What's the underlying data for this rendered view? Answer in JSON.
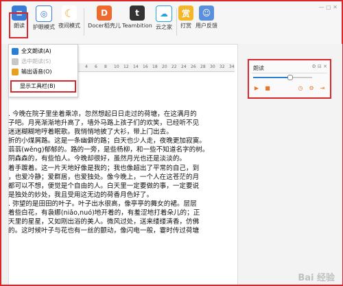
{
  "ribbon": {
    "read_label": "朗读",
    "eye_label": "护眼模式",
    "night_label": "夜间模式",
    "docer_label": "Docer稻壳儿",
    "teambition_label": "Teambition",
    "cloud_label": "云之家",
    "reward_label": "打赏",
    "feedback_label": "用户反馈"
  },
  "menu": {
    "full_read": "全文朗读(A)",
    "select_read": "选中朗读(S)",
    "output_voice": "输出语音(O)",
    "show_toolbar": "显示工具栏(B)"
  },
  "ruler": [
    "1",
    "2",
    "4",
    "6",
    "8",
    "10",
    "12",
    "14",
    "16",
    "18",
    "20",
    "22",
    "24",
    "26",
    "28",
    "30",
    "32",
    "34"
  ],
  "panel": {
    "title": "朗读",
    "progress": 0.62
  },
  "document": {
    "lines": [
      ". 今晚在院子里坐着乘凉，忽然想起日日走过的荷塘，在这满月的",
      "子吧。月亮渐渐地升高了，墙外马路上孩子们的欢笑，已经听不见",
      "迷迷糊糊地哼着眠歌。我悄悄地披了大衫，带上门出去。",
      "折的小煤屑路。这是一条幽僻的路；白天也少人走，夜晚更加寂寞。",
      "蓊蓊(wěng)郁郁的。路的一旁，是些杨柳，和一些不知道名字的树。",
      "阴森森的，有些怕人。今晚却很好，虽然月光也还是淡淡的。",
      "着手踱着。这一片天地好像是我的；我也像超出了平常的自己，到",
      "，也爱冷静；爱群居，也爱独处。像今晚上，一个人在这苍茫的月",
      "都可以不想，便觉是个自由的人。白天里一定要做的事，一定要说",
      "是独处的妙处，我且受用这无边的荷香月色好了。",
      ". 弥望的是田田的叶子。叶子出水很高，像亭亭的舞女的裙。层层",
      "着些白花，有袅娜(niǎo,nuó)地开着的，有羞涩地打着朵儿的；正",
      "天里的星星，又如刚出浴的美人。微风过处，送来缕缕清香，仿佛",
      "的。这时候叶子与花也有一丝的颤动，像闪电一般，霎时传过荷塘"
    ]
  },
  "watermark": "Bai 经验"
}
